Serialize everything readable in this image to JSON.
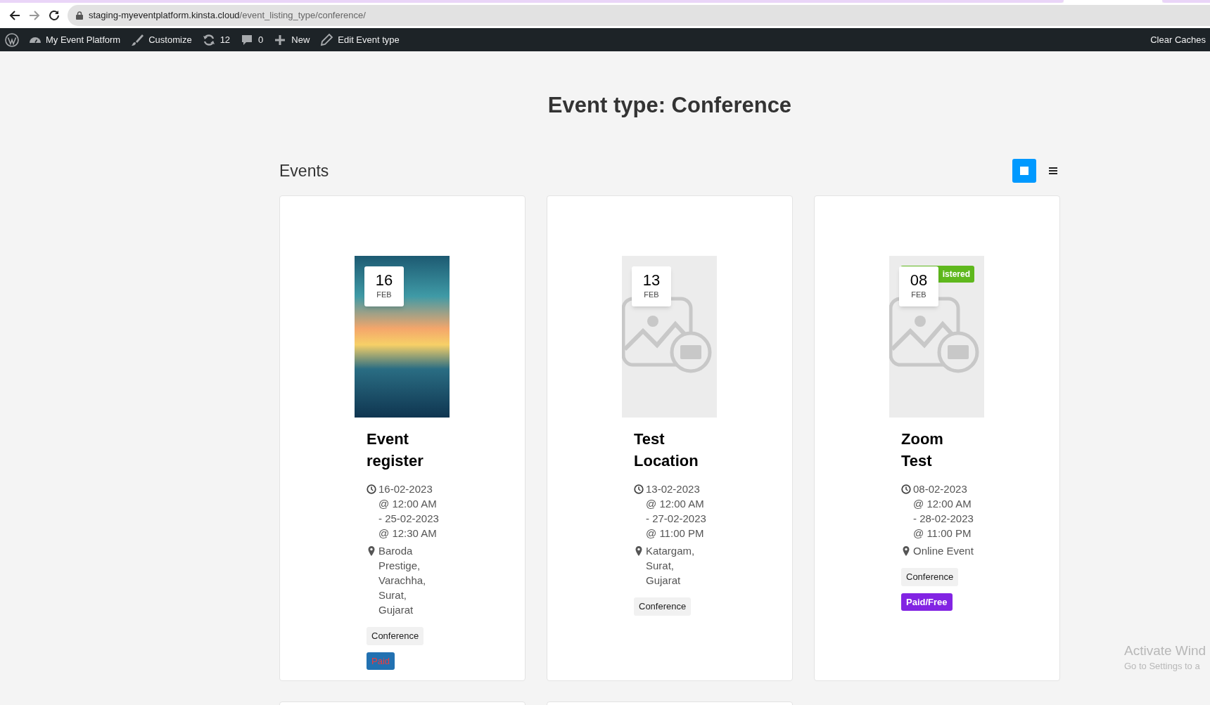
{
  "browser": {
    "url_host": "staging-myeventplatform.kinsta.cloud",
    "url_path": "/event_listing_type/conference/"
  },
  "admin_bar": {
    "items": [
      {
        "kind": "wp"
      },
      {
        "kind": "site",
        "label": "My Event Platform"
      },
      {
        "kind": "customize",
        "label": "Customize"
      },
      {
        "kind": "updates",
        "label": "12"
      },
      {
        "kind": "comments",
        "label": "0"
      },
      {
        "kind": "new",
        "label": "New"
      },
      {
        "kind": "edit",
        "label": "Edit Event type"
      }
    ],
    "right": "Clear Caches"
  },
  "page_title": "Event type: Conference",
  "section_title": "Events",
  "view_toggles": [
    {
      "kind": "grid",
      "selected": true
    },
    {
      "kind": "list",
      "selected": false
    }
  ],
  "events": [
    {
      "image": {
        "kind": "photo"
      },
      "day": "16",
      "month": "FEB",
      "title": "Event register",
      "datetime": "16-02-2023 @ 12:00 AM - 25-02-2023 @ 12:30 AM",
      "location": "Baroda Prestige, Varachha, Surat, Gujarat",
      "type": "Conference",
      "ticket": {
        "kind": "paid",
        "label": "Paid"
      }
    },
    {
      "image": {
        "kind": "placeholder"
      },
      "day": "13",
      "month": "FEB",
      "title": "Test Location",
      "datetime": "13-02-2023 @ 12:00 AM - 27-02-2023 @ 11:00 PM",
      "location": "Katargam, Surat, Gujarat",
      "type": "Conference"
    },
    {
      "image": {
        "kind": "placeholder"
      },
      "day": "08",
      "month": "FEB",
      "badge": "istered",
      "title": "Zoom Test",
      "datetime": "08-02-2023 @ 12:00 AM - 28-02-2023 @ 11:00 PM",
      "location": "Online Event",
      "type": "Conference",
      "ticket": {
        "kind": "paid_free",
        "label": "Paid/Free"
      }
    }
  ],
  "os_notice": {
    "title": "Activate Wind",
    "subtitle": "Go to Settings to a"
  }
}
